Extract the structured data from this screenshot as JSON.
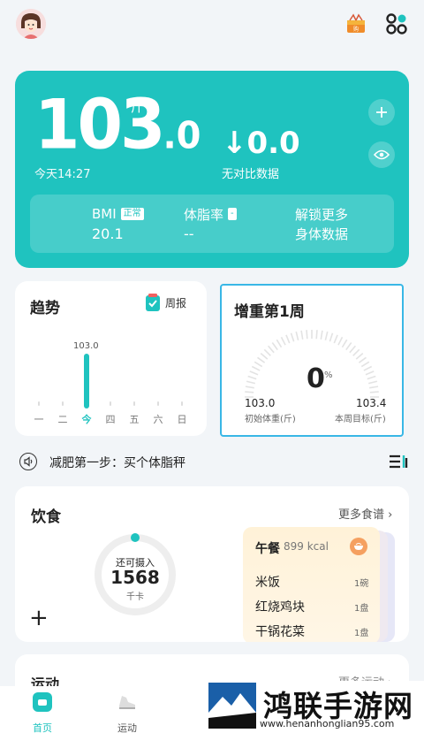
{
  "weight": {
    "value_int": "103",
    "value_dec": ".0",
    "unit": "斤",
    "time": "今天14:27",
    "delta": "↓0.0",
    "delta_label": "无对比数据"
  },
  "metrics": {
    "bmi_label": "BMI",
    "bmi_badge": "正常",
    "bmi_value": "20.1",
    "fat_label": "体脂率",
    "fat_badge": "-",
    "fat_value": "--",
    "unlock_line1": "解锁更多",
    "unlock_line2": "身体数据"
  },
  "trend": {
    "title": "趋势",
    "weekly_label": "周报",
    "bar_label": "103.0",
    "days": [
      "一",
      "二",
      "今",
      "四",
      "五",
      "六",
      "日"
    ]
  },
  "goal": {
    "title": "增重第1周",
    "percent": "0",
    "percent_sign": "%",
    "start_value": "103.0",
    "start_label": "初始体重(斤)",
    "target_value": "103.4",
    "target_label": "本周目标(斤)"
  },
  "notice": {
    "text": "减肥第一步：买个体脂秤"
  },
  "diet": {
    "title": "饮食",
    "more": "更多食谱 ›",
    "ring_top": "还可摄入",
    "ring_value": "1568",
    "ring_unit": "千卡",
    "plus": "+",
    "meal_name": "午餐",
    "meal_kcal": "899 kcal",
    "dishes": [
      {
        "name": "米饭",
        "qty": "1碗"
      },
      {
        "name": "红烧鸡块",
        "qty": "1盘"
      },
      {
        "name": "干锅花菜",
        "qty": "1盘"
      }
    ]
  },
  "sport": {
    "title": "运动",
    "more": "更多运动 ›"
  },
  "nav": {
    "home": "首页",
    "sport": "运动"
  },
  "watermark": {
    "title": "鸿联手游网",
    "url": "www.henanhonglian95.com"
  },
  "colors": {
    "accent": "#1fc3bf",
    "goal_border": "#39b7e6"
  }
}
